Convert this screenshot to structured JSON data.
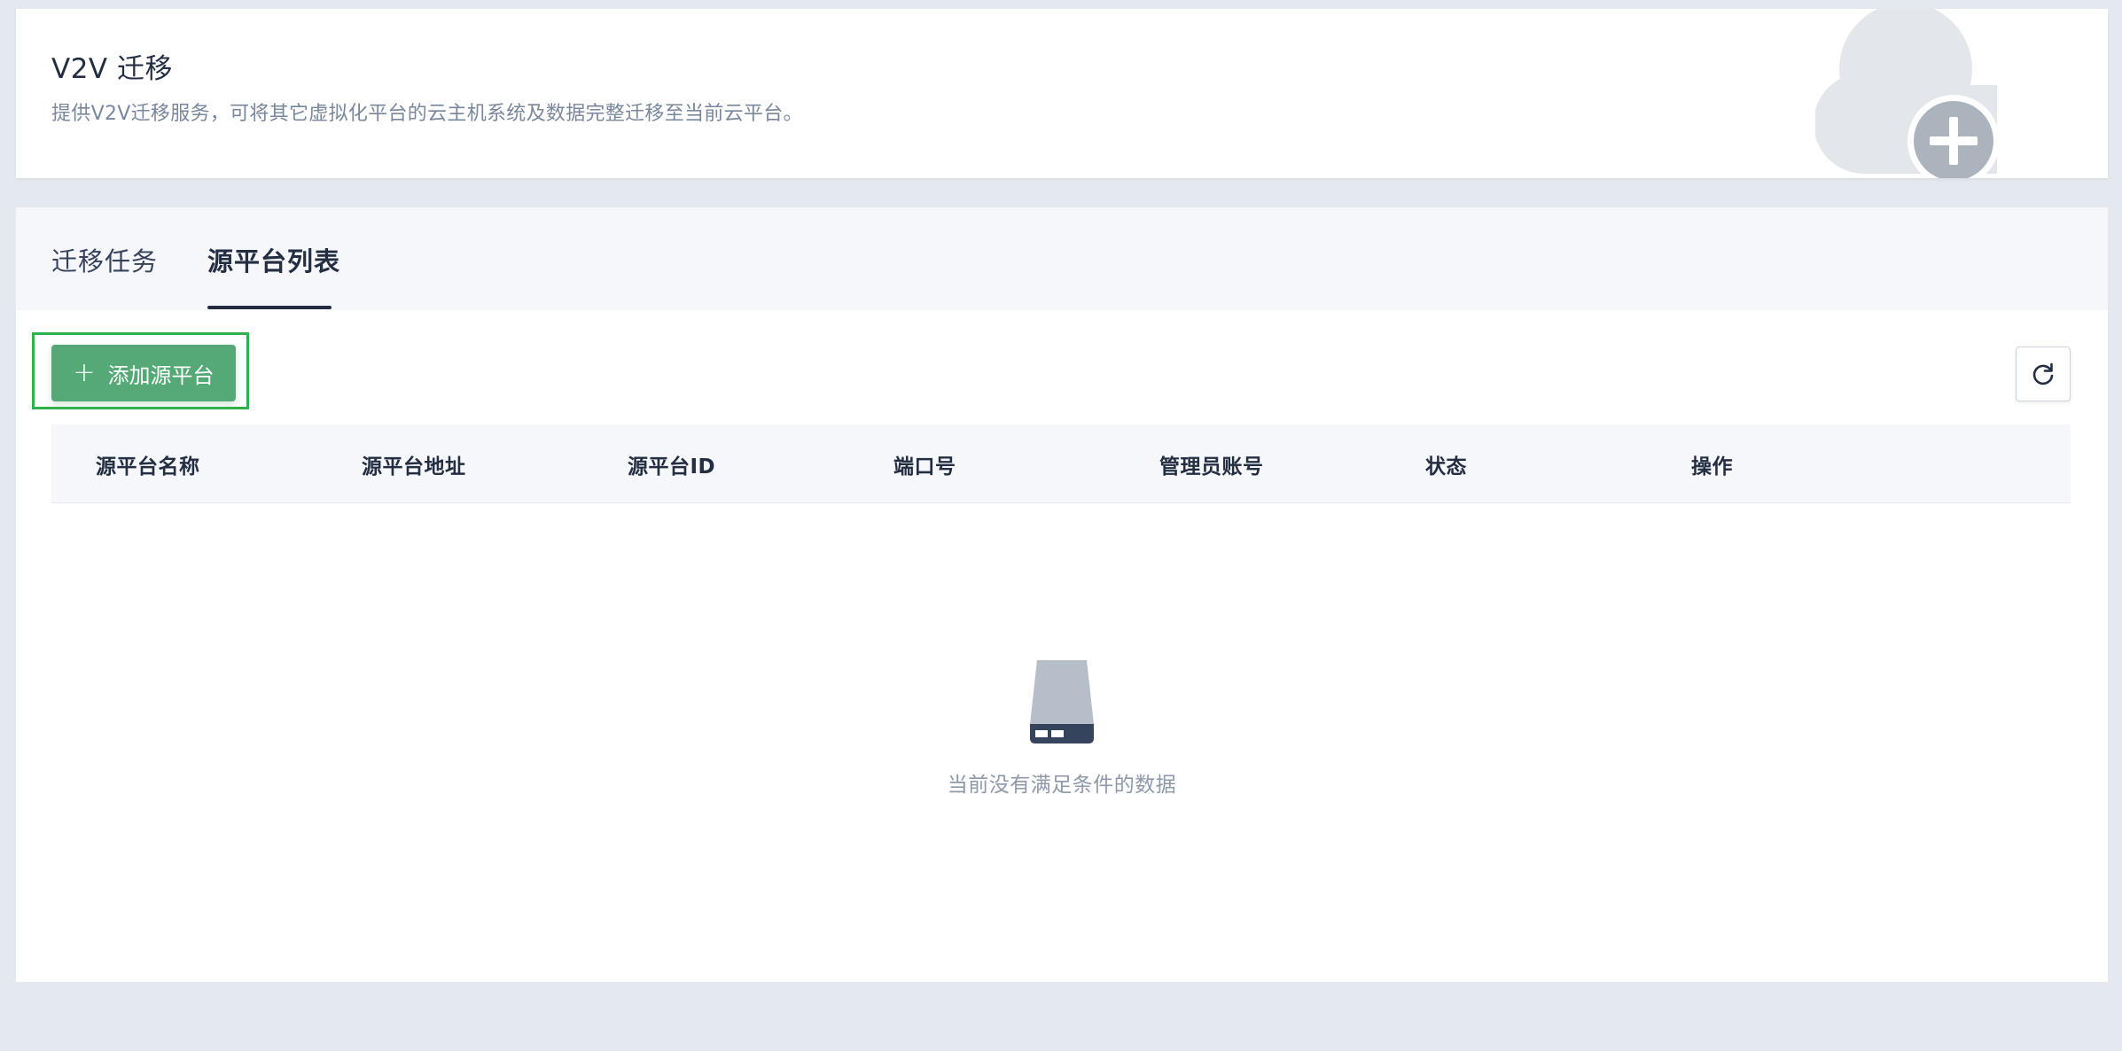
{
  "banner": {
    "title": "V2V 迁移",
    "description": "提供V2V迁移服务，可将其它虚拟化平台的云主机系统及数据完整迁移至当前云平台。"
  },
  "tabs": [
    {
      "label": "迁移任务",
      "active": false
    },
    {
      "label": "源平台列表",
      "active": true
    }
  ],
  "toolbar": {
    "add_label": "添加源平台",
    "add_icon": "plus-icon",
    "refresh_icon": "refresh-icon"
  },
  "table": {
    "columns": [
      "源平台名称",
      "源平台地址",
      "源平台ID",
      "端口号",
      "管理员账号",
      "状态",
      "操作"
    ],
    "rows": []
  },
  "empty_state": {
    "icon": "empty-disk-icon",
    "text": "当前没有满足条件的数据"
  },
  "colors": {
    "primary_button": "#55a976",
    "highlight_border": "#2fb24c",
    "page_background": "#e4e9ef",
    "text_dark": "#242e42",
    "text_muted": "#79879c"
  }
}
